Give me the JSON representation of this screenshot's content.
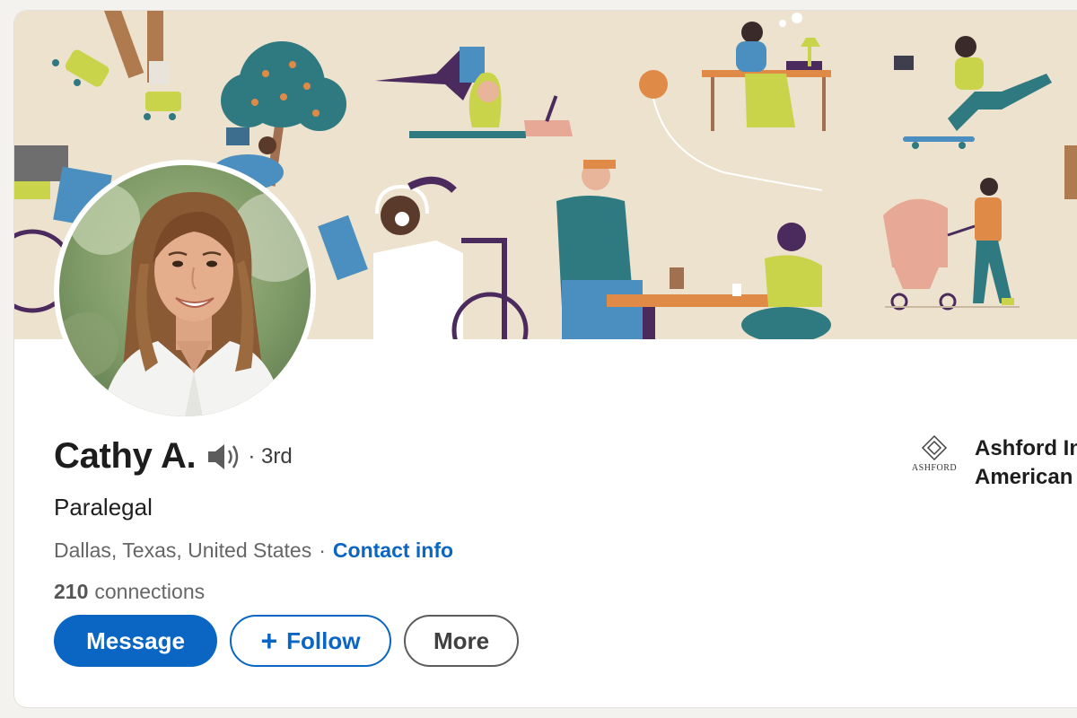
{
  "profile": {
    "name": "Cathy A.",
    "degree": "· 3rd",
    "headline": "Paralegal",
    "location": "Dallas, Texas, United States",
    "location_separator": "·",
    "contact_link": "Contact info",
    "connections_count": "210",
    "connections_label": "connections"
  },
  "actions": {
    "message": "Message",
    "follow_plus": "+",
    "follow": "Follow",
    "more": "More"
  },
  "company": {
    "logo_text": "ASHFORD",
    "line1": "Ashford In",
    "line2": "American"
  },
  "icons": {
    "pronunciation": "speaker-icon",
    "logo": "ashford-diamond-logo-icon"
  },
  "colors": {
    "primary": "#0a66c2",
    "banner_bg": "#ede2cd"
  }
}
